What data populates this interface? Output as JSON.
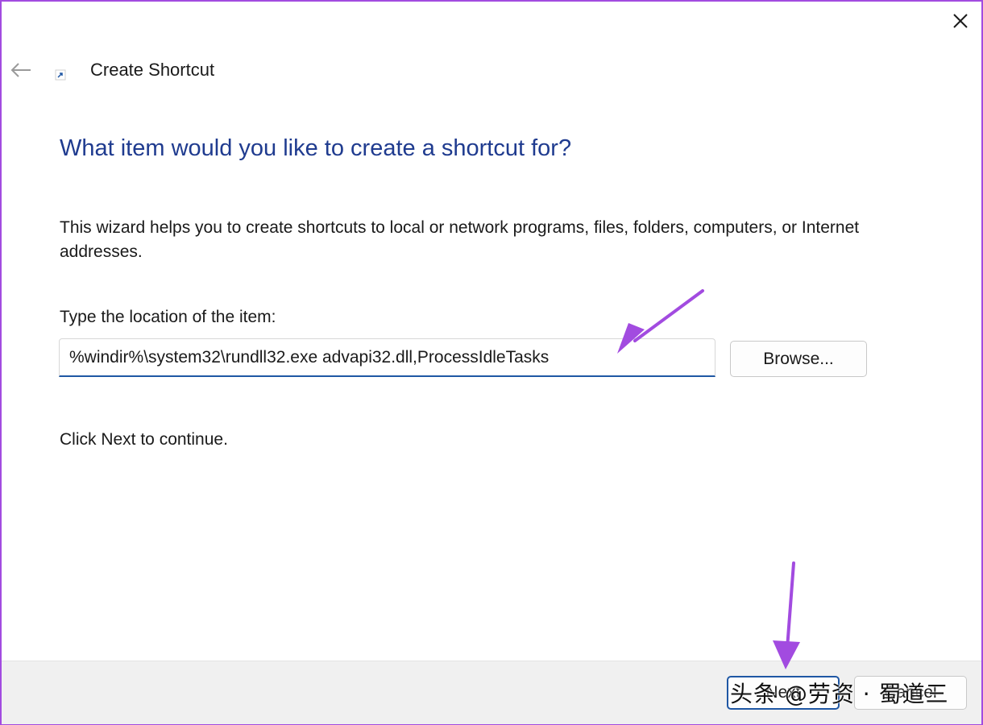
{
  "window": {
    "title": "Create Shortcut",
    "icons": {
      "close": "close-icon",
      "back": "back-arrow-icon",
      "app": "shortcut-icon"
    }
  },
  "content": {
    "heading": "What item would you like to create a shortcut for?",
    "description": "This wizard helps you to create shortcuts to local or network programs, files, folders, computers, or Internet addresses.",
    "location_label": "Type the location of the item:",
    "location_value": "%windir%\\system32\\rundll32.exe advapi32.dll,ProcessIdleTasks",
    "browse_label": "Browse...",
    "continue_text": "Click Next to continue."
  },
  "footer": {
    "next_label": "Next",
    "cancel_label": "Cancel"
  },
  "watermark": {
    "text": "头条 @劳资 · 蜀道三"
  },
  "colors": {
    "heading": "#1f3b8f",
    "accent": "#1f57a4",
    "frame_border": "#a24be0",
    "annotation_arrow": "#a24be0",
    "footer_bg": "#f0f0f0"
  }
}
